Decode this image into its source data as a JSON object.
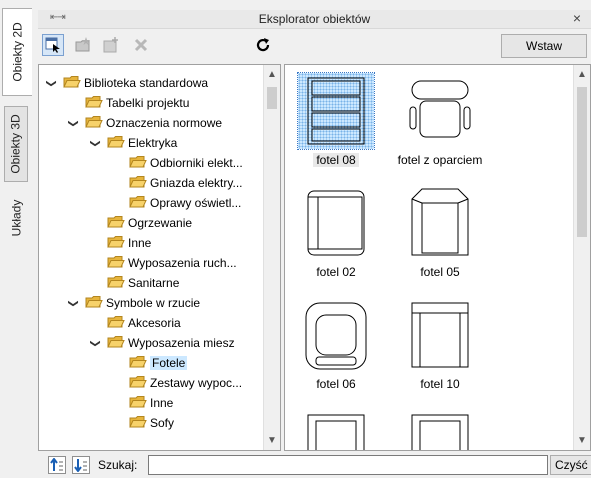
{
  "side_tabs": [
    "Obiekty 2D",
    "Obiekty 3D",
    "Układy"
  ],
  "panel": {
    "title": "Eksplorator obiektów",
    "close_glyph": "×",
    "grip_glyph": "⇤⇥"
  },
  "toolbar": {
    "insert_label": "Wstaw",
    "refresh_icon": "refresh-icon"
  },
  "tree": {
    "rows": [
      {
        "label": "Biblioteka standardowa",
        "expanded": true
      },
      {
        "label": "Tabelki projektu"
      },
      {
        "label": "Oznaczenia normowe",
        "expanded": true
      },
      {
        "label": "Elektryka",
        "expanded": true
      },
      {
        "label": "Odbiorniki elekt..."
      },
      {
        "label": "Gniazda elektry..."
      },
      {
        "label": "Oprawy oświetl..."
      },
      {
        "label": "Ogrzewanie"
      },
      {
        "label": "Inne"
      },
      {
        "label": "Wyposazenia ruch..."
      },
      {
        "label": "Sanitarne"
      },
      {
        "label": "Symbole w rzucie",
        "expanded": true
      },
      {
        "label": "Akcesoria"
      },
      {
        "label": "Wyposazenia miesz",
        "expanded": true
      },
      {
        "label": "Fotele",
        "selected": true
      },
      {
        "label": "Zestawy wypoc..."
      },
      {
        "label": "Inne"
      },
      {
        "label": "Sofy"
      }
    ]
  },
  "grid": {
    "items": [
      {
        "label": "fotel 08",
        "selected": true
      },
      {
        "label": "fotel z oparciem"
      },
      {
        "label": "fotel 02"
      },
      {
        "label": "fotel 05"
      },
      {
        "label": "fotel 06"
      },
      {
        "label": "fotel 10"
      }
    ]
  },
  "search": {
    "label": "Szukaj:",
    "value": "",
    "clear_label": "Czyść"
  },
  "colors": {
    "selection": "#cce8ff",
    "folder": "#f2c94c",
    "accent": "#3a78c5"
  }
}
